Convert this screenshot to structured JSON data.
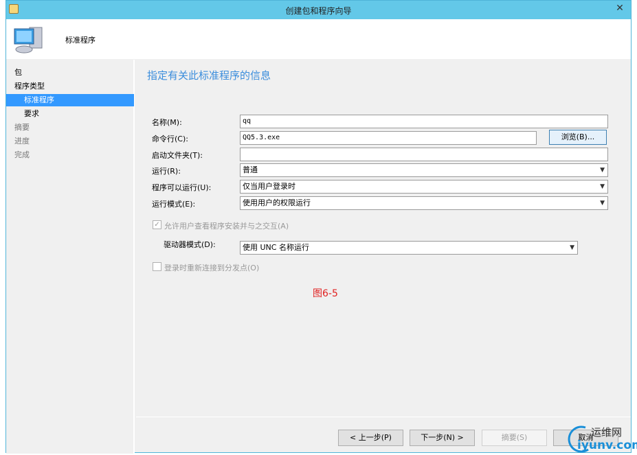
{
  "window": {
    "title": "创建包和程序向导",
    "close": "✕"
  },
  "header": {
    "title": "标准程序"
  },
  "sidebar": {
    "items": [
      {
        "label": "包"
      },
      {
        "label": "程序类型"
      },
      {
        "label": "标准程序"
      },
      {
        "label": "要求"
      },
      {
        "label": "摘要"
      },
      {
        "label": "进度"
      },
      {
        "label": "完成"
      }
    ]
  },
  "main": {
    "heading": "指定有关此标准程序的信息",
    "name_label": "名称(M):",
    "name_value": "qq",
    "cmd_label": "命令行(C):",
    "cmd_value": "QQ5.3.exe",
    "browse": "浏览(B)...",
    "startdir_label": "启动文件夹(T):",
    "startdir_value": "",
    "run_label": "运行(R):",
    "run_value": "普通",
    "canrun_label": "程序可以运行(U):",
    "canrun_value": "仅当用户登录时",
    "mode_label": "运行模式(E):",
    "mode_value": "使用用户的权限运行",
    "allow_label": "允许用户查看程序安装并与之交互(A)",
    "allow_checked": true,
    "drive_label": "驱动器模式(D):",
    "drive_value": "使用 UNC 名称运行",
    "reconnect_label": "登录时重新连接到分发点(O)",
    "reconnect_checked": false,
    "caption": "图6-5"
  },
  "footer": {
    "prev": "< 上一步(P)",
    "next": "下一步(N) >",
    "summary": "摘要(S)",
    "cancel": "取消"
  },
  "watermark": {
    "text": "运维网",
    "url_text": "iyunv.com"
  }
}
